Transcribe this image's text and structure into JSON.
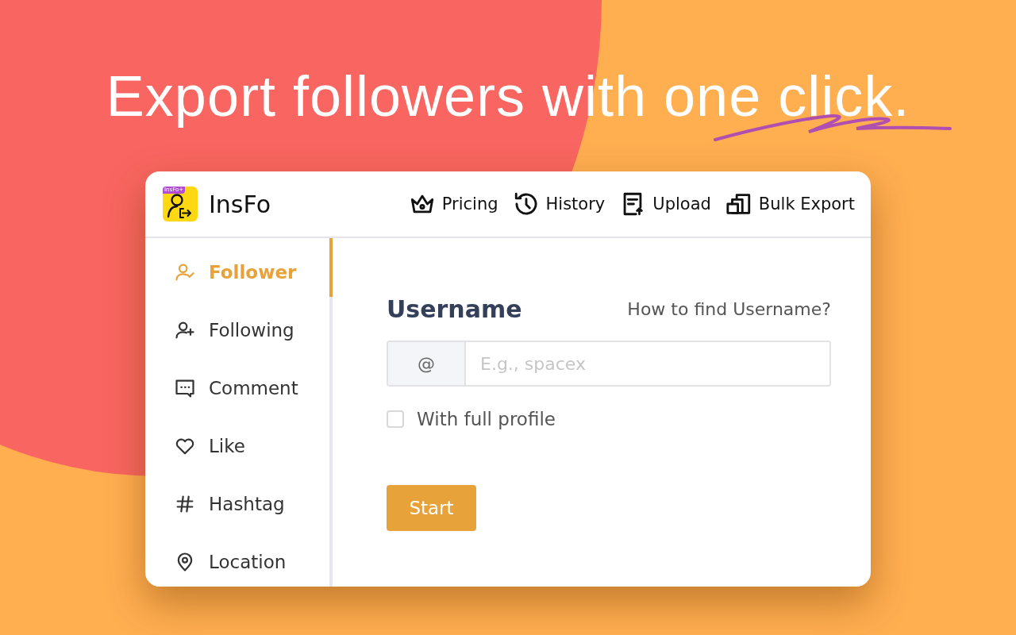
{
  "headline": "Export followers with one click.",
  "app": {
    "logo_badge": "InsFo+",
    "name": "InsFo",
    "nav": [
      {
        "label": "Pricing"
      },
      {
        "label": "History"
      },
      {
        "label": "Upload"
      },
      {
        "label": "Bulk Export"
      }
    ],
    "sidebar": [
      {
        "label": "Follower",
        "selected": true
      },
      {
        "label": "Following",
        "selected": false
      },
      {
        "label": "Comment",
        "selected": false
      },
      {
        "label": "Like",
        "selected": false
      },
      {
        "label": "Hashtag",
        "selected": false
      },
      {
        "label": "Location",
        "selected": false
      }
    ],
    "form": {
      "label": "Username",
      "help_link": "How to find Username?",
      "prefix": "@",
      "placeholder": "E.g., spacex",
      "checkbox": {
        "label": "With full profile",
        "checked": false
      },
      "button": "Start"
    }
  }
}
